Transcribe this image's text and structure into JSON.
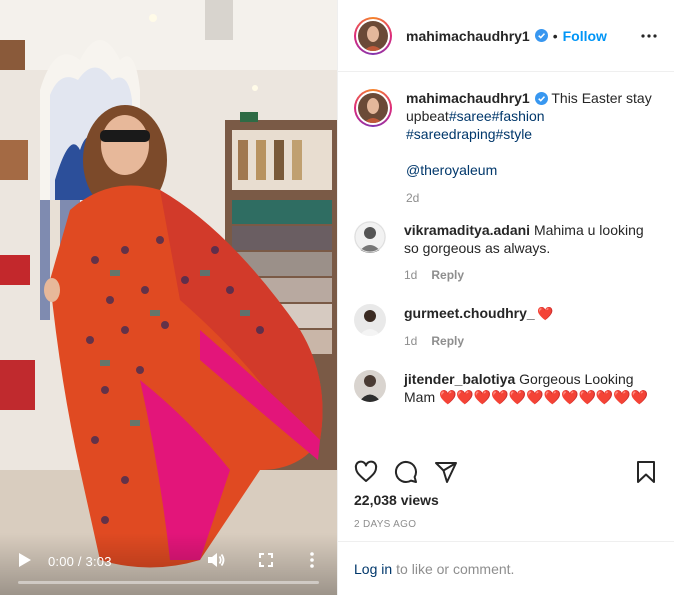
{
  "video": {
    "elapsed": "0:00",
    "duration": "3:03",
    "time_separator": "/",
    "progress": 0
  },
  "post": {
    "username": "mahimachaudhry1",
    "verified": true,
    "separator": "•",
    "follow_label": "Follow"
  },
  "caption": {
    "username": "mahimachaudhry1",
    "text": " This Easter stay upbeat",
    "hashtags": [
      "#saree",
      "#fashion",
      "#sareedraping",
      "#style"
    ],
    "mention": "@theroyaleum",
    "age": "2d"
  },
  "comments": [
    {
      "username": "vikramaditya.adani",
      "text": " Mahima u looking so gorgeous as always.",
      "age": "1d",
      "reply_label": "Reply"
    },
    {
      "username": "gurmeet.choudhry_",
      "text": " ❤️",
      "age": "1d",
      "reply_label": "Reply"
    },
    {
      "username": "jitender_balotiya",
      "text": " Gorgeous Looking Mam ❤️❤️❤️❤️❤️❤️❤️❤️❤️❤️❤️❤️"
    }
  ],
  "stats": {
    "views": "22,038 views",
    "posted": "2 DAYS AGO"
  },
  "footer": {
    "login_label": "Log in",
    "suffix": "to like or comment."
  },
  "icons": {
    "play": "play-icon",
    "volume": "volume-icon",
    "fullscreen": "fullscreen-icon",
    "more": "more-vertical-icon",
    "like": "heart-icon",
    "comment": "comment-icon",
    "share": "paper-plane-icon",
    "save": "bookmark-icon"
  },
  "colors": {
    "accent": "#0095f6",
    "link": "#00376b",
    "muted": "#8e8e8e",
    "heart": "#ed4956",
    "verified": "#3897f0"
  }
}
